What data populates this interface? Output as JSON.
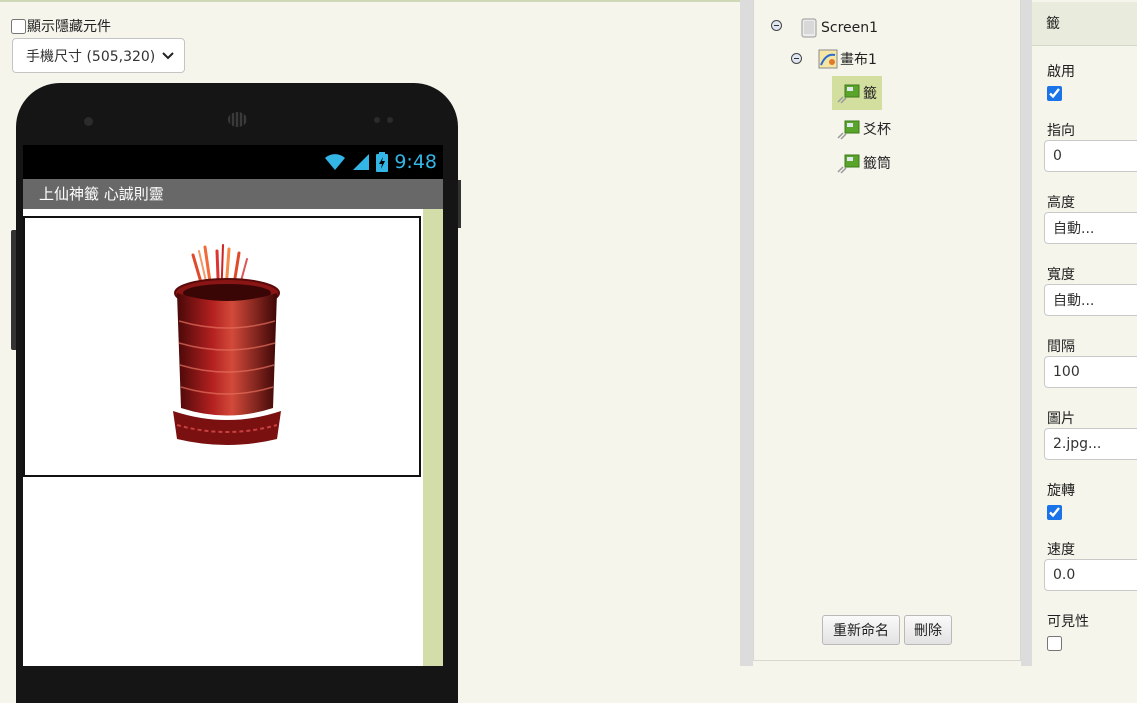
{
  "viewer": {
    "show_hidden_label": "顯示隱藏元件",
    "show_hidden_checked": false,
    "device_size": "手機尺寸 (505,320)",
    "phone": {
      "clock": "9:48",
      "app_title": "上仙神籤 心誠則靈"
    }
  },
  "components": {
    "tree": [
      {
        "label": "Screen1",
        "icon": "screen-icon"
      },
      {
        "label": "畫布1",
        "icon": "canvas-icon"
      },
      {
        "label": "籤",
        "icon": "sprite-icon",
        "selected": true
      },
      {
        "label": "爻杯",
        "icon": "sprite-icon"
      },
      {
        "label": "籤筒",
        "icon": "sprite-icon"
      }
    ],
    "rename_label": "重新命名",
    "delete_label": "刪除"
  },
  "properties": {
    "header": "籤",
    "enabled_label": "啟用",
    "enabled_checked": true,
    "heading_label": "指向",
    "heading_value": "0",
    "height_label": "高度",
    "height_value": "自動...",
    "width_label": "寬度",
    "width_value": "自動...",
    "interval_label": "間隔",
    "interval_value": "100",
    "picture_label": "圖片",
    "picture_value": "2.jpg...",
    "rotates_label": "旋轉",
    "rotates_checked": true,
    "speed_label": "速度",
    "speed_value": "0.0",
    "visible_label": "可見性",
    "visible_checked": false
  },
  "colors": {
    "accent_green": "#d3df9e",
    "status_blue": "#33b5e5",
    "checkbox_blue": "#1a73e8"
  }
}
